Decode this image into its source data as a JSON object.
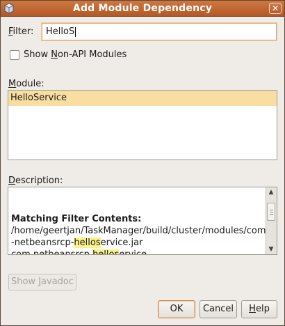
{
  "window": {
    "title": "Add Module Dependency",
    "close_glyph": "✕",
    "app_icon": "module-cube-icon"
  },
  "filter": {
    "label_mnemonic": "F",
    "label_rest": "ilter:",
    "value": "HelloS"
  },
  "show_non_api": {
    "label_before": "Show ",
    "label_mnemonic": "N",
    "label_after": "on-API Modules",
    "checked": false
  },
  "module_list": {
    "label_mnemonic": "M",
    "label_rest": "odule:",
    "items": [
      {
        "label": "HelloService",
        "selected": true
      }
    ]
  },
  "description": {
    "label_mnemonic": "D",
    "label_rest": "escription:",
    "heading": "Matching Filter Contents:",
    "line1": "/home/geertjan/TaskManager/build/cluster/modules/com",
    "line2_before": "-netbeansrcp-",
    "line2_highlight": "hellos",
    "line2_after": "ervice.jar",
    "line3_before": "com.netbeansrcp.",
    "line3_highlight": "hellos",
    "line3_after": "ervice"
  },
  "buttons": {
    "javadoc_before": "Show ",
    "javadoc_mnemonic": "J",
    "javadoc_after": "avadoc",
    "ok": "OK",
    "cancel": "Cancel",
    "help_mnemonic": "H",
    "help_rest": "elp"
  },
  "colors": {
    "titlebar": "#c0662f",
    "selection": "#f8dea0",
    "highlight": "#fbf28a"
  }
}
